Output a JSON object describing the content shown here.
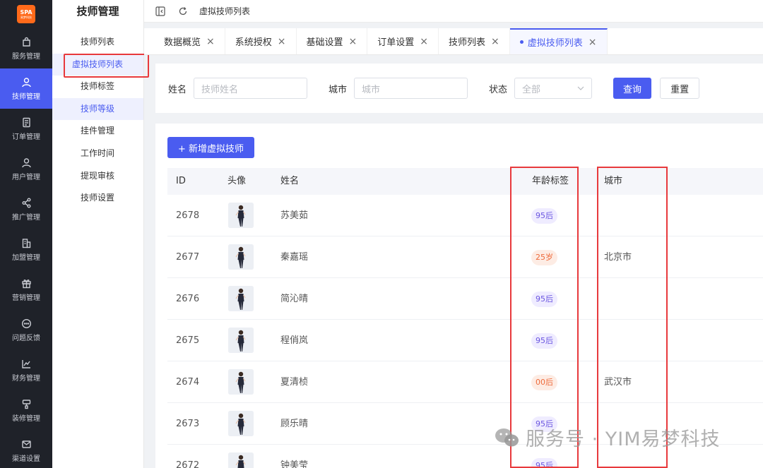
{
  "rail": {
    "logo_text": "SPA",
    "logo_sub": "易梦科技",
    "items": [
      {
        "label": "服务管理",
        "icon": "bag-icon"
      },
      {
        "label": "技师管理",
        "icon": "user-icon",
        "active": true
      },
      {
        "label": "订单管理",
        "icon": "document-icon"
      },
      {
        "label": "用户管理",
        "icon": "person-icon"
      },
      {
        "label": "推广管理",
        "icon": "share-icon"
      },
      {
        "label": "加盟管理",
        "icon": "building-icon"
      },
      {
        "label": "营销管理",
        "icon": "gift-icon"
      },
      {
        "label": "问题反馈",
        "icon": "chat-icon"
      },
      {
        "label": "财务管理",
        "icon": "chart-icon"
      },
      {
        "label": "装修管理",
        "icon": "brush-icon"
      },
      {
        "label": "渠道设置",
        "icon": "mail-icon"
      }
    ]
  },
  "submenu": {
    "title": "技师管理",
    "items": [
      "技师列表",
      "虚拟技师列表",
      "技师标签",
      "技师等级",
      "挂件管理",
      "工作时间",
      "提现审核",
      "技师设置"
    ]
  },
  "topbar": {
    "breadcrumb": "虚拟技师列表"
  },
  "tabs": [
    {
      "label": "数据概览"
    },
    {
      "label": "系统授权"
    },
    {
      "label": "基础设置"
    },
    {
      "label": "订单设置"
    },
    {
      "label": "技师列表"
    },
    {
      "label": "虚拟技师列表",
      "active": true
    }
  ],
  "filter": {
    "name_label": "姓名",
    "name_placeholder": "技师姓名",
    "city_label": "城市",
    "city_placeholder": "城市",
    "status_label": "状态",
    "status_value": "全部",
    "search_label": "查询",
    "reset_label": "重置"
  },
  "main": {
    "add_label": "+ 新增虚拟技师",
    "columns": {
      "id": "ID",
      "avatar": "头像",
      "name": "姓名",
      "age_tag": "年龄标签",
      "city": "城市"
    },
    "rows": [
      {
        "id": "2678",
        "name": "苏美茹",
        "age_tag": "95后",
        "tag_color": "purple",
        "city": ""
      },
      {
        "id": "2677",
        "name": "秦嘉瑶",
        "age_tag": "25岁",
        "tag_color": "orange",
        "city": "北京市"
      },
      {
        "id": "2676",
        "name": "简沁晴",
        "age_tag": "95后",
        "tag_color": "purple",
        "city": ""
      },
      {
        "id": "2675",
        "name": "程俏岚",
        "age_tag": "95后",
        "tag_color": "purple",
        "city": ""
      },
      {
        "id": "2674",
        "name": "夏清桢",
        "age_tag": "00后",
        "tag_color": "orange",
        "city": "武汉市"
      },
      {
        "id": "2673",
        "name": "顾乐晴",
        "age_tag": "95后",
        "tag_color": "purple",
        "city": ""
      },
      {
        "id": "2672",
        "name": "钟美莹",
        "age_tag": "95后",
        "tag_color": "purple",
        "city": ""
      }
    ]
  },
  "watermark": "服务号 · YIM易梦科技",
  "colors": {
    "accent": "#4a5cf0",
    "rail_bg": "#1f2229",
    "highlight_red": "#e8393c"
  }
}
